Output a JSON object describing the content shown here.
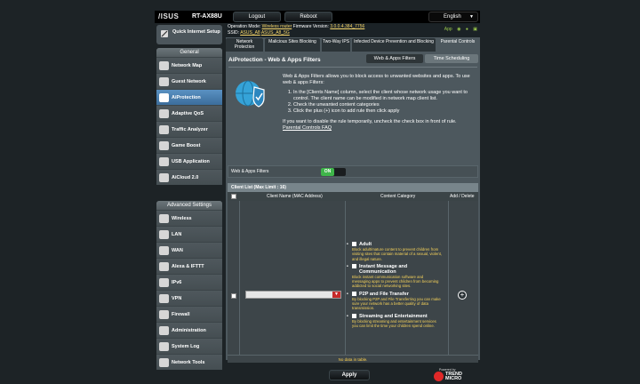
{
  "header": {
    "logo": "/ISUS",
    "model": "RT-AX88U",
    "logout": "Logout",
    "reboot": "Reboot",
    "language": "English"
  },
  "status": {
    "op_mode_label": "Operation Mode:",
    "op_mode_value": "Wireless router",
    "fw_label": "Firmware Version:",
    "fw_value": "3.0.0.4.384_7756",
    "ssid_label": "SSID:",
    "ssid_1": "ASUS_A8",
    "ssid_2": "ASUS_A8_5G",
    "app_label": "App"
  },
  "sidebar": {
    "quick_setup": "Quick Internet Setup",
    "general_title": "General",
    "general_items": [
      "Network Map",
      "Guest Network",
      "AiProtection",
      "Adaptive QoS",
      "Traffic Analyzer",
      "Game Boost",
      "USB Application",
      "AiCloud 2.0"
    ],
    "advanced_title": "Advanced Settings",
    "advanced_items": [
      "Wireless",
      "LAN",
      "WAN",
      "Alexa & IFTTT",
      "IPv6",
      "VPN",
      "Firewall",
      "Administration",
      "System Log",
      "Network Tools"
    ]
  },
  "tabs": [
    "Network Protection",
    "Malicious Sites Blocking",
    "Two-Way IPS",
    "Infected Device Prevention and Blocking",
    "Parental Controls"
  ],
  "page": {
    "title": "AiProtection - Web & Apps Filters",
    "subtab_active": "Web & Apps Filters",
    "subtab_other": "Time Scheduling",
    "intro": "Web & Apps Filters allows you to block access to unwanted websites and apps. To use web & apps Filters:",
    "steps": [
      "In the [Clients Name] column, select the client whose network usage you want to control. The client name can be modified in network map client list.",
      "Check the unwanted content categories",
      "Click the plus (+) icon to add rule then click apply"
    ],
    "disable_note": "If you want to disable the rule temporarily, uncheck the check box in front of rule.",
    "faq": "Parental Controls FAQ",
    "filter_label": "Web & Apps Filters",
    "toggle": "ON",
    "client_list": "Client List (Max Limit : 16)",
    "col_client": "Client Name (MAC Address)",
    "col_category": "Content Category",
    "col_add": "Add / Delete",
    "categories": [
      {
        "name": "Adult",
        "desc": "Block adult/mature content to prevent children from visiting sites that contain material of a sexual, violent, and illegal nature."
      },
      {
        "name": "Instant Message and Communication",
        "desc": "Block instant communication software and messaging apps to prevent children from becoming addicted to social networking sites."
      },
      {
        "name": "P2P and File Transfer",
        "desc": "By blocking P2P and File Transferring you can make sure your network has a better quality of data transmission."
      },
      {
        "name": "Streaming and Entertainment",
        "desc": "By blocking streaming and entertainment services you can limit the time your children spend online."
      }
    ],
    "no_data": "No data in table.",
    "apply": "Apply",
    "powered_by": "Powered by",
    "trend": "TREND MICRO"
  }
}
